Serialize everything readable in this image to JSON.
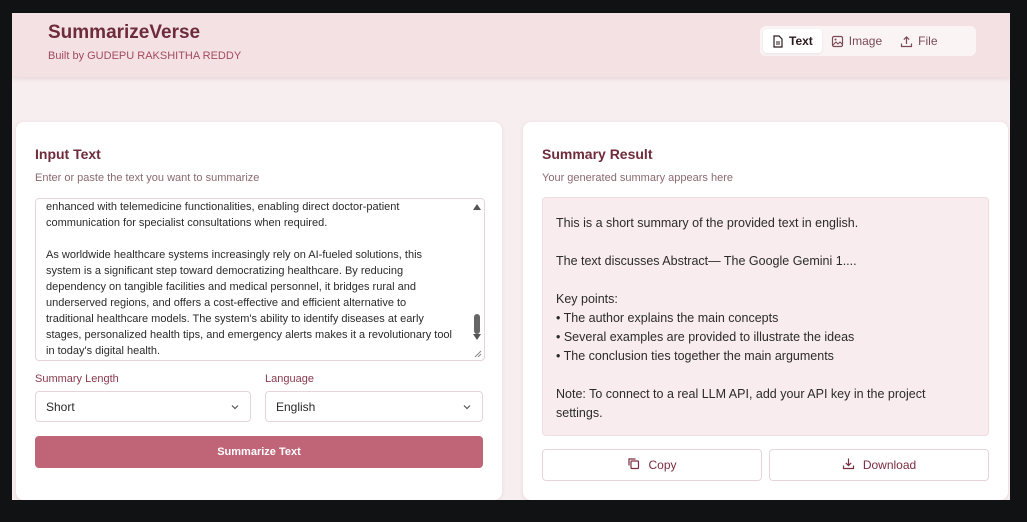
{
  "header": {
    "title": "SummarizeVerse",
    "subtitle": "Built by GUDEPU RAKSHITHA REDDY",
    "tabs": [
      {
        "label": "Text",
        "icon": "document-icon",
        "active": true
      },
      {
        "label": "Image",
        "icon": "image-icon",
        "active": false
      },
      {
        "label": "File",
        "icon": "upload-icon",
        "active": false
      }
    ]
  },
  "input_card": {
    "title": "Input Text",
    "subtitle": "Enter or paste the text you want to summarize",
    "text": "enhanced with telemedicine functionalities, enabling direct doctor-patient\ncommunication for specialist consultations when required.\n\nAs worldwide healthcare systems increasingly rely on AI-fueled solutions, this\nsystem is a significant step toward democratizing healthcare. By reducing\ndependency on tangible facilities and medical personnel, it bridges rural and\nunderserved regions, and offers a cost-effective and efficient alternative to\ntraditional healthcare models. The system's ability to identify diseases at early\nstages, personalized health tips, and emergency alerts makes it a revolutionary tool\nin today's digital health.",
    "length_label": "Summary Length",
    "length_value": "Short",
    "language_label": "Language",
    "language_value": "English",
    "submit_label": "Summarize Text"
  },
  "result_card": {
    "title": "Summary Result",
    "subtitle": "Your generated summary appears here",
    "lines": [
      "This is a short summary of the provided text in english.",
      "",
      "The text discusses Abstract— The Google Gemini 1....",
      "",
      "Key points:",
      "• The author explains the main concepts",
      "• Several examples are provided to illustrate the ideas",
      "• The conclusion ties together the main arguments",
      "",
      "Note: To connect to a real LLM API, add your API key in the project",
      "settings."
    ],
    "copy_label": "Copy",
    "download_label": "Download"
  },
  "colors": {
    "brand": "#6e2b3a",
    "accent": "#c06478",
    "header_bg": "#f3e1e4",
    "result_bg": "#f8ecee"
  }
}
